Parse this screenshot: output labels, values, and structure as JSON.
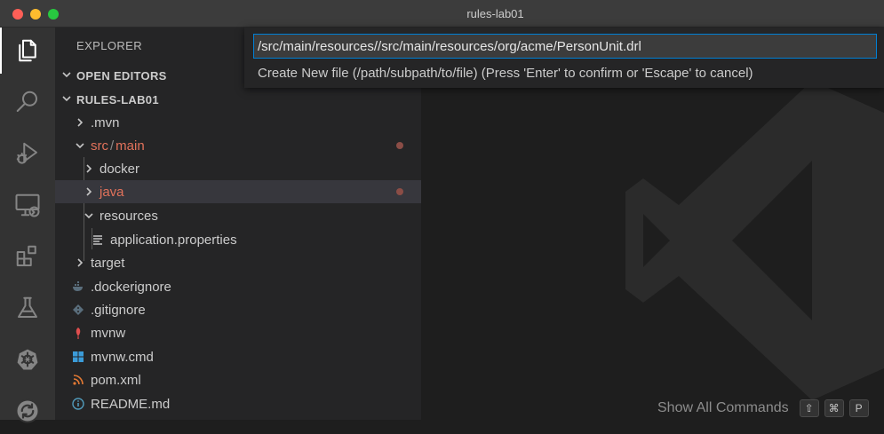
{
  "window": {
    "title": "rules-lab01"
  },
  "activity_bar": {
    "items": [
      {
        "icon": "files-icon",
        "active": true
      },
      {
        "icon": "search-icon",
        "active": false
      },
      {
        "icon": "run-debug-icon",
        "active": false
      },
      {
        "icon": "remote-explorer-icon",
        "active": false
      },
      {
        "icon": "extensions-icon",
        "active": false
      },
      {
        "icon": "testing-flask-icon",
        "active": false
      },
      {
        "icon": "kubernetes-icon",
        "active": false
      },
      {
        "icon": "sync-icon",
        "active": false
      }
    ]
  },
  "sidebar": {
    "title": "EXPLORER",
    "open_editors": "OPEN EDITORS",
    "workspace": "RULES-LAB01",
    "tree": [
      {
        "name": ".mvn",
        "type": "folder",
        "expanded": false
      },
      {
        "name": "src",
        "type": "folder",
        "expanded": true,
        "modified": true
      },
      {
        "name": "main",
        "type": "folder",
        "expanded": true,
        "modified": true
      },
      {
        "name": "docker",
        "type": "folder",
        "expanded": false
      },
      {
        "name": "java",
        "type": "folder",
        "expanded": false,
        "modified": true,
        "selected": true
      },
      {
        "name": "resources",
        "type": "folder",
        "expanded": true
      },
      {
        "name": "application.properties",
        "type": "file",
        "icon": "properties-file-icon"
      },
      {
        "name": "target",
        "type": "folder",
        "expanded": false
      },
      {
        "name": ".dockerignore",
        "type": "file",
        "icon": "docker-icon"
      },
      {
        "name": ".gitignore",
        "type": "file",
        "icon": "git-icon"
      },
      {
        "name": "mvnw",
        "type": "file",
        "icon": "maven-feather-icon"
      },
      {
        "name": "mvnw.cmd",
        "type": "file",
        "icon": "windows-icon"
      },
      {
        "name": "pom.xml",
        "type": "file",
        "icon": "rss-xml-icon"
      },
      {
        "name": "README.md",
        "type": "file",
        "icon": "info-icon"
      }
    ],
    "path_separator": "/"
  },
  "quick_input": {
    "value": "/src/main/resources//src/main/resources/org/acme/PersonUnit.drl",
    "message": "Create New file (/path/subpath/to/file) (Press 'Enter' to confirm or 'Escape' to cancel)"
  },
  "editor_hints": {
    "show_all_commands": "Show All Commands",
    "keys": [
      "⇧",
      "⌘",
      "P"
    ]
  },
  "colors": {
    "accent_focus": "#007fd4",
    "modified": "#e2725b",
    "sidebar_bg": "#252526",
    "editor_bg": "#1e1e1e"
  }
}
